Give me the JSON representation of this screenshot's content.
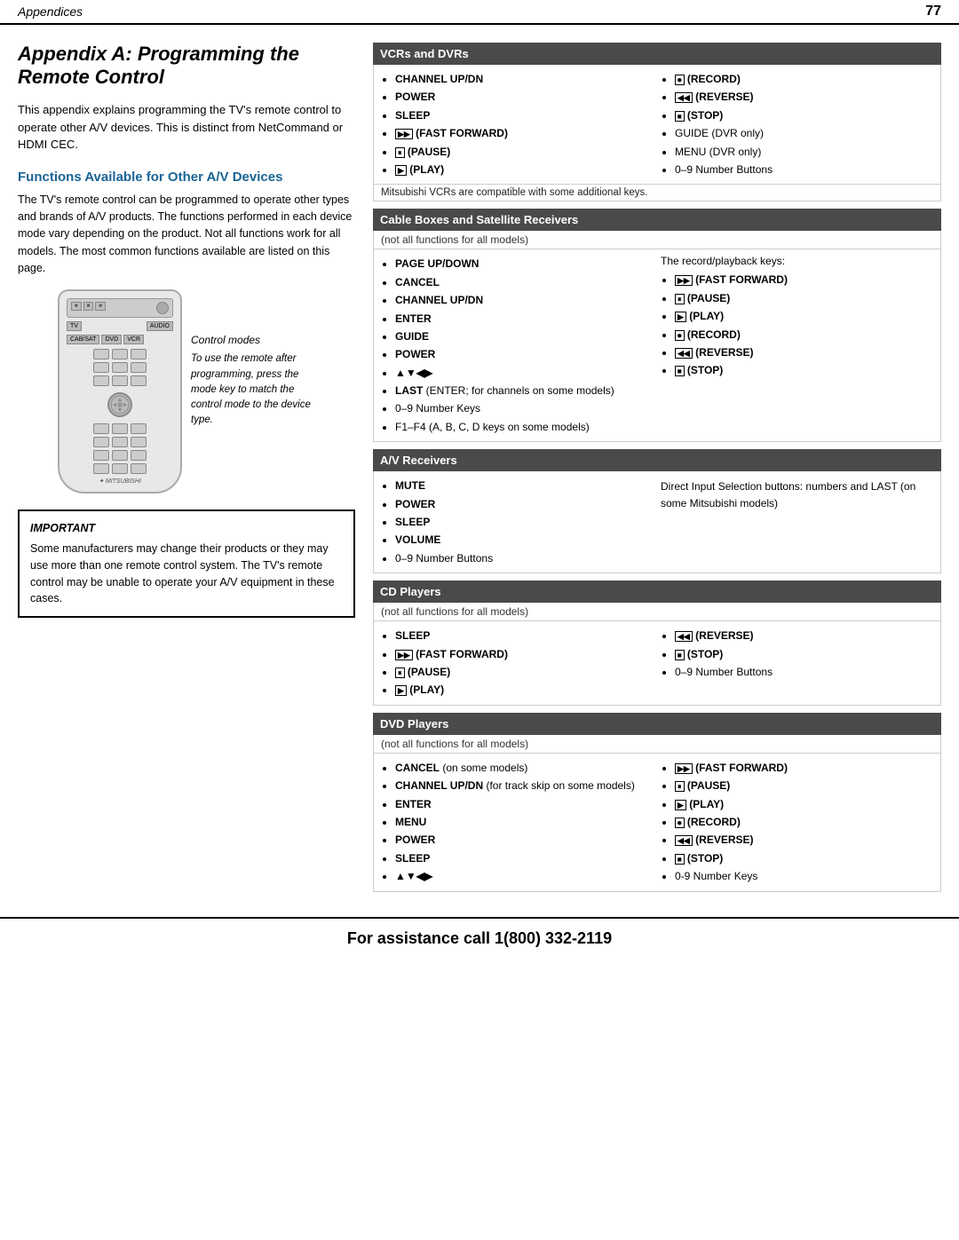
{
  "header": {
    "title": "Appendices",
    "page_number": "77"
  },
  "page_title": "Appendix A:  Programming the Remote Control",
  "intro": "This appendix explains programming the TV's remote control to operate other A/V devices.  This is distinct from NetCommand or HDMI CEC.",
  "functions_section": {
    "heading": "Functions Available for Other A/V Devices",
    "body": "The TV's remote control can be programmed to operate other types and brands of A/V products. The functions performed in each device mode vary depending on the product.  Not all functions work for all models. The most common functions available are listed on this page."
  },
  "control_modes_label": "Control modes",
  "control_modes_text": "To use the remote after programming, press the mode key to match the control mode to the device type.",
  "important": {
    "label": "IMPORTANT",
    "text": "Some manufacturers may change their products or they may use more than one remote control system.  The TV's remote control may be unable to operate your A/V equipment in these cases."
  },
  "vcrs_dvrs": {
    "header": "VCRs and DVRs",
    "col1": [
      "CHANNEL UP/DN",
      "POWER",
      "SLEEP",
      "▶▶ (FAST FORWARD)",
      "⏸ (PAUSE)",
      "▶ (PLAY)"
    ],
    "col2": [
      "⏺ (RECORD)",
      "◀◀ (REVERSE)",
      "⏹ (STOP)",
      "GUIDE (DVR only)",
      "MENU (DVR only)",
      "0–9 Number Buttons"
    ],
    "note": "Mitsubishi VCRs are compatible with some additional keys."
  },
  "cable_boxes": {
    "header": "Cable Boxes and Satellite Receivers",
    "subheader": "(not all functions for all models)",
    "col1": [
      "PAGE UP/DOWN",
      "CANCEL",
      "CHANNEL UP/DN",
      "ENTER",
      "GUIDE",
      "POWER",
      "▲▼◀▶",
      "LAST (ENTER; for channels on some models)",
      "0–9 Number Keys",
      "F1–F4 (A, B, C, D keys on some models)"
    ],
    "col2_label": "The record/playback keys:",
    "col2": [
      "▶▶ (FAST FORWARD)",
      "⏸ (PAUSE)",
      "▶ (PLAY)",
      "⏺ (RECORD)",
      "◀◀ (REVERSE)",
      "⏹ (STOP)"
    ]
  },
  "av_receivers": {
    "header": "A/V Receivers",
    "col1": [
      "MUTE",
      "POWER",
      "SLEEP",
      "VOLUME",
      "0–9 Number Buttons"
    ],
    "col2_text": "Direct Input Selection buttons:  numbers and LAST (on some Mitsubishi models)"
  },
  "cd_players": {
    "header": "CD Players",
    "subheader": "(not all functions for all models)",
    "col1": [
      "SLEEP",
      "▶▶ (FAST FORWARD)",
      "⏸ (PAUSE)",
      "▶ (PLAY)"
    ],
    "col2": [
      "◀◀ (REVERSE)",
      "⏹ (STOP)",
      "0–9 Number Buttons"
    ]
  },
  "dvd_players": {
    "header": "DVD Players",
    "subheader": "(not all functions for all models)",
    "col1": [
      "CANCEL (on some models)",
      "CHANNEL UP/DN (for track skip on some models)",
      "ENTER",
      "MENU",
      "POWER",
      "SLEEP",
      "▲▼◀▶"
    ],
    "col2": [
      "▶▶ (FAST FORWARD)",
      "⏸ (PAUSE)",
      "▶ (PLAY)",
      "⏺ (RECORD)",
      "◀◀ (REVERSE)",
      "⏹ (STOP)",
      "0-9 Number Keys"
    ]
  },
  "footer": "For assistance call 1(800) 332-2119",
  "remote": {
    "tv_label": "TV",
    "audio_label": "AUDIO",
    "cabsat_label": "CAB/SAT",
    "dvd_label": "DVD",
    "vcr_label": "VCR"
  }
}
